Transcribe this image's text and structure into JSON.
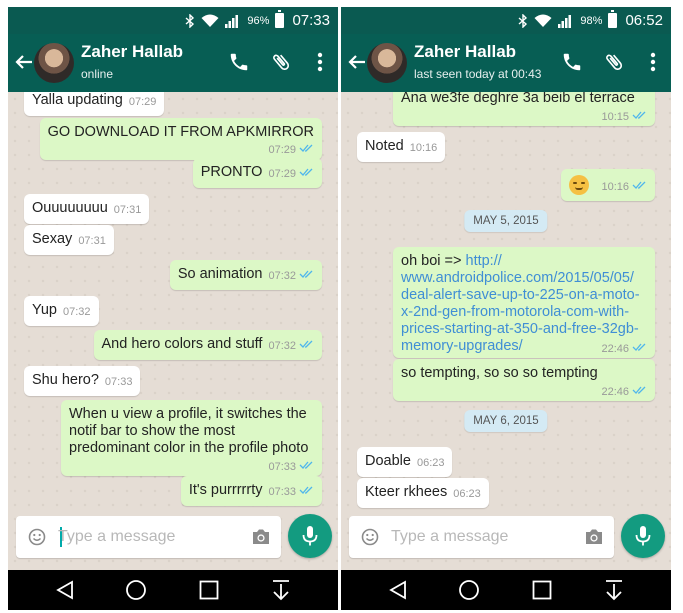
{
  "left": {
    "status": {
      "battery": "96%",
      "time": "07:33"
    },
    "header": {
      "name": "Zaher Hallab",
      "status": "online"
    },
    "messages": [
      {
        "dir": "in",
        "text": "Yalla updating",
        "time": "07:29"
      },
      {
        "dir": "out",
        "text": "GO DOWNLOAD IT FROM APKMIRROR",
        "time": "07:29"
      },
      {
        "dir": "out",
        "text": "PRONTO",
        "time": "07:29"
      },
      {
        "dir": "in",
        "text": "Ouuuuuuuu",
        "time": "07:31"
      },
      {
        "dir": "in",
        "text": "Sexay",
        "time": "07:31"
      },
      {
        "dir": "out",
        "text": "So animation",
        "time": "07:32"
      },
      {
        "dir": "in",
        "text": "Yup",
        "time": "07:32"
      },
      {
        "dir": "out",
        "text": "And hero colors and stuff",
        "time": "07:32"
      },
      {
        "dir": "in",
        "text": "Shu hero?",
        "time": "07:33"
      },
      {
        "dir": "out",
        "lines": [
          "When u view a profile, it switches the",
          "notif bar to show the most",
          "predominant color in the profile photo"
        ],
        "time": "07:33"
      },
      {
        "dir": "out",
        "text": "It's purrrrrty",
        "time": "07:33"
      }
    ],
    "input": {
      "placeholder": "Type a message"
    }
  },
  "right": {
    "status": {
      "battery": "98%",
      "time": "06:52"
    },
    "header": {
      "name": "Zaher Hallab",
      "status": "last seen today at 00:43"
    },
    "messages": [
      {
        "dir": "out",
        "text": "Ana we3fe deghre 3a beib el terrace",
        "time": "10:15"
      },
      {
        "dir": "in",
        "text": "Noted",
        "time": "10:16"
      },
      {
        "dir": "out",
        "emoji": "smirking-face",
        "time": "10:16"
      },
      {
        "date": "MAY 5, 2015"
      },
      {
        "dir": "out",
        "prefix": "oh boi => ",
        "link_lines": [
          "http://",
          "www.androidpolice.com/2015/05/05/",
          "deal-alert-save-up-to-225-on-a-moto-",
          "x-2nd-gen-from-motorola-com-with-",
          "prices-starting-at-350-and-free-32gb-",
          "memory-upgrades/"
        ],
        "time": "22:46"
      },
      {
        "dir": "out",
        "text": "so tempting, so so so tempting",
        "time": "22:46"
      },
      {
        "date": "MAY 6, 2015"
      },
      {
        "dir": "in",
        "text": "Doable",
        "time": "06:23"
      },
      {
        "dir": "in",
        "text": "Kteer rkhees",
        "time": "06:23"
      }
    ],
    "input": {
      "placeholder": "Type a message"
    }
  },
  "colors": {
    "status_bar": "#0a5a51",
    "app_bar": "#075e54",
    "outgoing_bubble": "#dcf8c6",
    "incoming_bubble": "#ffffff",
    "date_chip": "#d4eaf4",
    "mic_button": "#139b80",
    "read_ticks": "#4fb6ec"
  },
  "icons": [
    "bluetooth-icon",
    "wifi-icon",
    "signal-icon",
    "battery-icon",
    "back-arrow-icon",
    "call-icon",
    "attach-icon",
    "more-icon",
    "emoji-icon",
    "camera-icon",
    "mic-icon",
    "nav-back-icon",
    "nav-home-icon",
    "nav-recents-icon",
    "nav-down-icon"
  ]
}
